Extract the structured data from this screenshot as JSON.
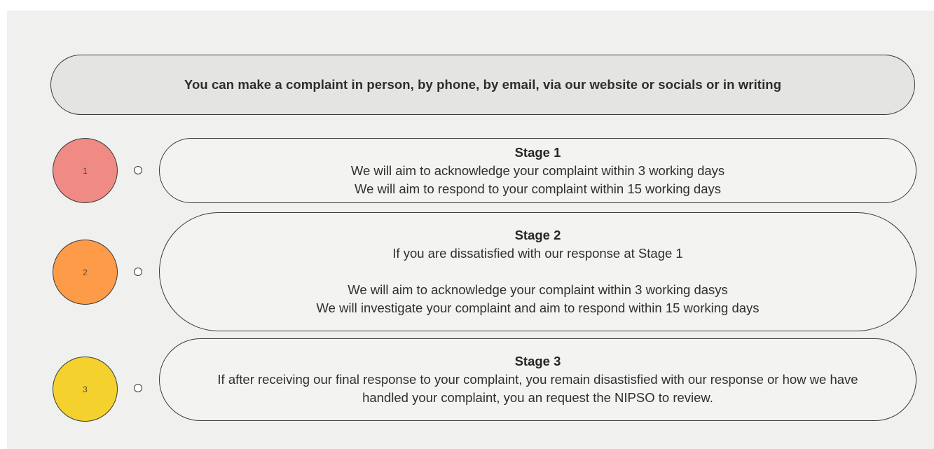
{
  "banner": {
    "text": "You can make a complaint in person, by phone, by email, via our website or socials or in writing"
  },
  "stages": [
    {
      "marker": "1",
      "marker_color": "#ef8a84",
      "title": "Stage 1",
      "lines": [
        "We will aim to acknowledge your complaint within 3 working days",
        "We will aim to respond to your complaint within 15 working days"
      ]
    },
    {
      "marker": "2",
      "marker_color": "#fd9b48",
      "title": "Stage 2",
      "lines": [
        "If you are dissatisfied with our response at Stage 1",
        "We will aim to acknowledge your complaint within 3 working dasys",
        "We will investigate your complaint and aim to respond within 15 working days"
      ]
    },
    {
      "marker": "3",
      "marker_color": "#f5d12e",
      "title": "Stage 3",
      "lines": [
        "If after receiving our final response to your complaint, you remain disastisfied with our response or how we have",
        "handled your complaint, you an request the NIPSO to review."
      ]
    }
  ]
}
